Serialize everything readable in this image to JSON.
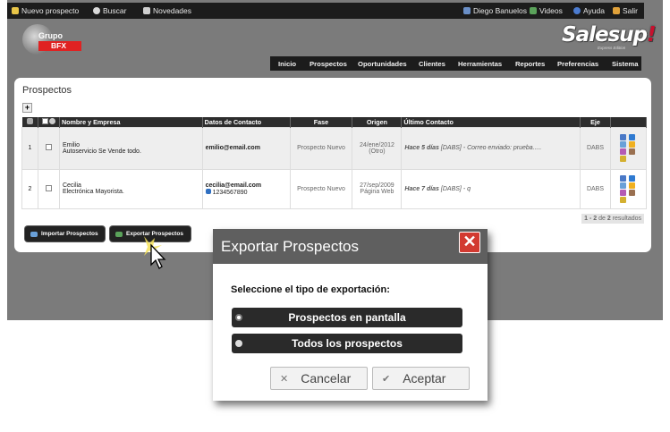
{
  "topbar": {
    "left": [
      {
        "label": "Nuevo prospecto",
        "icon": "add-person-icon"
      },
      {
        "label": "Buscar",
        "icon": "search-icon"
      },
      {
        "label": "Novedades",
        "icon": "news-icon"
      }
    ],
    "right": [
      {
        "label": "Diego Banuelos",
        "icon": "user-icon"
      },
      {
        "label": "Videos",
        "icon": "video-icon"
      },
      {
        "label": "Ayuda",
        "icon": "help-icon"
      },
      {
        "label": "Salir",
        "icon": "exit-icon"
      }
    ]
  },
  "logo": {
    "line1": "Grupo",
    "line2": "BFX"
  },
  "brand": {
    "name": "Salesup",
    "mark": "!",
    "edition": "Express Edition"
  },
  "nav": [
    "Inicio",
    "Prospectos",
    "Oportunidades",
    "Clientes",
    "Herramientas",
    "Reportes",
    "Preferencias",
    "Sistema"
  ],
  "panel": {
    "title": "Prospectos",
    "add_label": "+",
    "columns": [
      "Nombre y Empresa",
      "Datos de Contacto",
      "Fase",
      "Origen",
      "Último Contacto",
      "Eje"
    ],
    "rows": [
      {
        "num": "1",
        "name": "Emilio",
        "company": "Autoservicio Se Vende todo.",
        "email": "emilio@email.com",
        "phone": "",
        "fase": "Prospecto Nuevo",
        "origen_date": "24/ene/2012",
        "origen_src": "(Otro)",
        "contact_when": "Hace 5 días",
        "contact_tag": "[DABS]",
        "contact_text": "- Correo enviado: prueba.....",
        "eje": "DABS"
      },
      {
        "num": "2",
        "name": "Cecilia",
        "company": "Electrónica Mayorista.",
        "email": "cecilia@email.com",
        "phone": "1234567890",
        "fase": "Prospecto Nuevo",
        "origen_date": "27/sep/2009",
        "origen_src": "Página Web",
        "contact_when": "Hace 7 días",
        "contact_tag": "[DABS]",
        "contact_text": "- q",
        "eje": "DABS"
      }
    ],
    "results": {
      "range": "1 - 2",
      "of": "de",
      "total": "2",
      "suffix": "resultados"
    },
    "import_label": "Importar Prospectos",
    "export_label": "Exportar Prospectos"
  },
  "dialog": {
    "title": "Exportar Prospectos",
    "close": "✕",
    "prompt": "Seleccione el tipo de exportación:",
    "options": [
      "Prospectos en pantalla",
      "Todos los prospectos"
    ],
    "selected_option": 0,
    "cancel_label": "Cancelar",
    "accept_label": "Aceptar"
  },
  "colors": {
    "topbar": "#1c1c1c",
    "app_bg": "#7b7b7b",
    "logo_red": "#e02222",
    "close_red": "#d23a31",
    "dialog_header": "#5f5f5f"
  }
}
